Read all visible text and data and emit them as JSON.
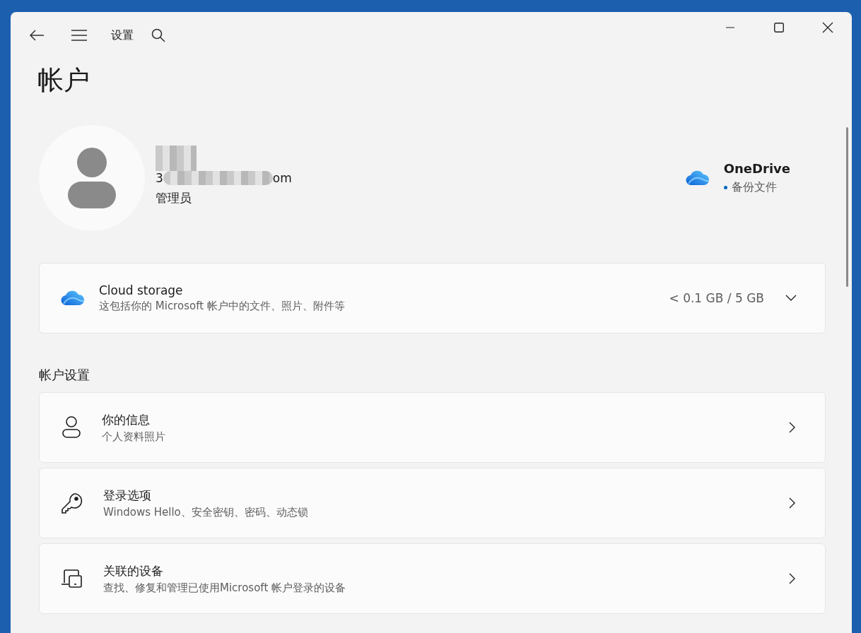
{
  "window": {
    "title": "设置"
  },
  "page_title": "帐户",
  "account": {
    "email_start": "3",
    "email_end": "om",
    "role": "管理员"
  },
  "onedrive": {
    "title": "OneDrive",
    "status": "备份文件"
  },
  "cloud_storage": {
    "title": "Cloud storage",
    "description": "这包括你的 Microsoft 帐户中的文件、照片、附件等",
    "usage": "< 0.1 GB / 5 GB",
    "expanded": false
  },
  "section_title": "帐户设置",
  "items": [
    {
      "kind": "person",
      "title": "你的信息",
      "description": "个人资料照片"
    },
    {
      "kind": "key",
      "title": "登录选项",
      "description": "Windows Hello、安全密钥、密码、动态锁"
    },
    {
      "kind": "devices",
      "title": "关联的设备",
      "description": "查找、修复和管理已使用Microsoft 帐户登录的设备"
    }
  ]
}
